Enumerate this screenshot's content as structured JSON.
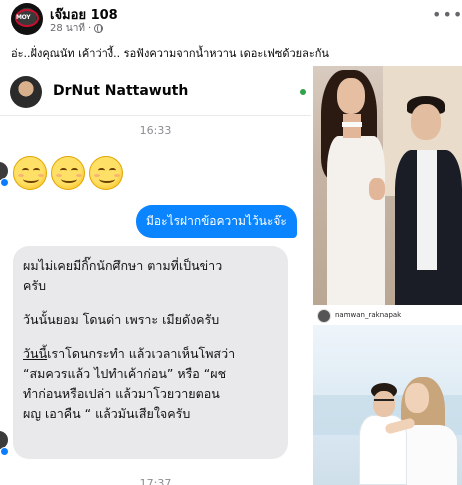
{
  "post": {
    "page_name": "เจ๊มอย 108",
    "time": "28 นาที",
    "separator": "·",
    "more_label": "•••",
    "caption": "อ่ะ..ฝั่งคุณนัท เค้าว่างี้.. รอฟังความจากน้ำหวาน เดอะเฟซด้วยละกัน",
    "avatar_text": "MOY"
  },
  "chat": {
    "contact_name": "DrNut Nattawuth",
    "timestamp_1": "16:33",
    "outgoing_message": "มีอะไรฝากข้อความไว้นะจ๊ะ",
    "incoming": {
      "line1": "ผมไม่เคยมีกิ๊กนักศึกษา ตามที่เป็นข่าว",
      "line2": "ครับ",
      "line3": "วันนั้นยอม โดนด่า เพราะ เมียดังครับ",
      "line4_underlined": "วันนี้",
      "line4_rest": "เราโดนกระทำ แล้วเวลาเห็นโพสว่า",
      "line5": "“สมควรแล้ว ไปทำเค้าก่อน” หรือ “ผช",
      "line6": "ทำก่อนหรือเปล่า แล้วมาโวยวายตอน",
      "line7": "ผญ เอาคืน “ แล้วมันเสียใจครับ"
    },
    "timestamp_2": "17:37"
  },
  "instagram": {
    "username": "namwan_raknapak"
  },
  "colors": {
    "messenger_blue": "#0a84ff",
    "bubble_gray": "#e9e9eb",
    "online_green": "#31a24c"
  }
}
